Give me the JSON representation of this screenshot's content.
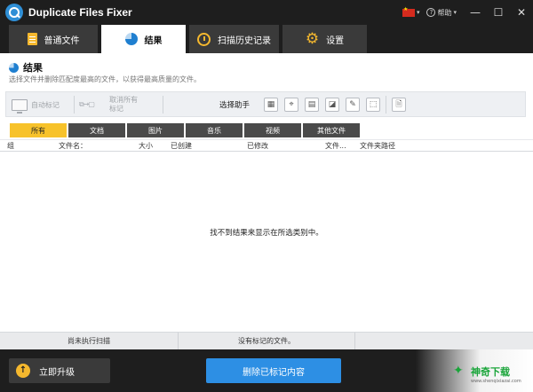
{
  "window": {
    "title": "Duplicate Files Fixer",
    "help_label": "帮助",
    "controls": {
      "minimize": "—",
      "maximize": "☐",
      "close": "✕"
    }
  },
  "tabs": [
    {
      "label": "普通文件",
      "icon": "document-icon",
      "active": false
    },
    {
      "label": "结果",
      "icon": "pie-chart-icon",
      "active": true
    },
    {
      "label": "扫描历史记录",
      "icon": "history-clock-icon",
      "active": false
    },
    {
      "label": "设置",
      "icon": "gear-icon",
      "active": false
    }
  ],
  "results": {
    "title": "结果",
    "subtitle": "选择文件并删除匹配度最高的文件，以获得最高质量的文件。"
  },
  "toolbar": {
    "auto_mark": "自动标记",
    "unmark_all": "取消所有\n标记",
    "selection_helper": "选择助手"
  },
  "filters": [
    {
      "label": "所有",
      "active": true
    },
    {
      "label": "文档",
      "active": false
    },
    {
      "label": "图片",
      "active": false
    },
    {
      "label": "音乐",
      "active": false
    },
    {
      "label": "视频",
      "active": false
    },
    {
      "label": "其他文件",
      "active": false
    }
  ],
  "table": {
    "columns": [
      "组",
      "文件名：",
      "大小",
      "已创建",
      "已修改",
      "文件...",
      "文件夹路径"
    ],
    "empty_message": "找不到结果来显示在所选类别中。"
  },
  "status": {
    "scan_status": "尚未执行扫描",
    "marked_status": "没有标记的文件。"
  },
  "footer": {
    "upgrade_label": "立即升级",
    "delete_label": "删除已标记内容"
  },
  "watermark": {
    "text": "神奇下载",
    "url": "www.shenqixiazai.com"
  },
  "colors": {
    "accent_blue": "#2d8fe4",
    "accent_yellow": "#f7c22a",
    "dark_bg": "#1e1e1e"
  }
}
